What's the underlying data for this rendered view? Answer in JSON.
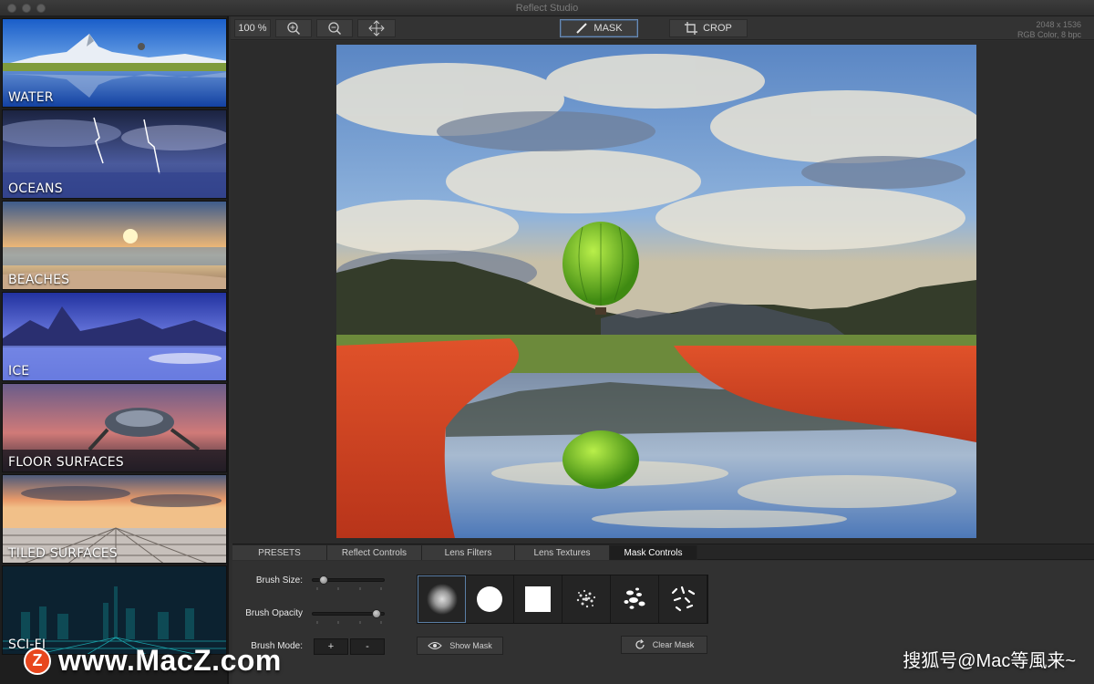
{
  "window": {
    "title": "Reflect Studio"
  },
  "presets": [
    {
      "label": "WATER"
    },
    {
      "label": "OCEANS"
    },
    {
      "label": "BEACHES"
    },
    {
      "label": "ICE"
    },
    {
      "label": "FLOOR SURFACES"
    },
    {
      "label": "TILED SURFACES"
    },
    {
      "label": "SCI-FI"
    }
  ],
  "toolbar": {
    "zoom_level": "100 %",
    "zoom_in_icon": "zoom-in-icon",
    "zoom_out_icon": "zoom-out-icon",
    "move_icon": "move-icon",
    "mask_label": "MASK",
    "crop_label": "CROP",
    "image_size": "2048 x 1536",
    "image_mode": "RGB Color, 8 bpc"
  },
  "tabs": [
    {
      "label": "PRESETS"
    },
    {
      "label": "Reflect Controls"
    },
    {
      "label": "Lens Filters"
    },
    {
      "label": "Lens Textures"
    },
    {
      "label": "Mask Controls",
      "active": true
    }
  ],
  "mask_controls": {
    "brush_size_label": "Brush Size:",
    "brush_size_value": 0.1,
    "brush_opacity_label": "Brush Opacity",
    "brush_opacity_value": 0.95,
    "brush_mode_label": "Brush Mode:",
    "mode_add": "+",
    "mode_subtract": "-",
    "brushes": [
      "soft-round",
      "hard-round",
      "square",
      "spray",
      "splatter",
      "scatter"
    ],
    "show_mask_label": "Show Mask",
    "clear_mask_label": "Clear Mask"
  },
  "watermarks": {
    "left_badge": "Z",
    "left": "www.MacZ.com",
    "right": "搜狐号@Mac等風来~"
  },
  "colors": {
    "accent": "#5b7fa6",
    "mask_overlay": "#d84020"
  }
}
